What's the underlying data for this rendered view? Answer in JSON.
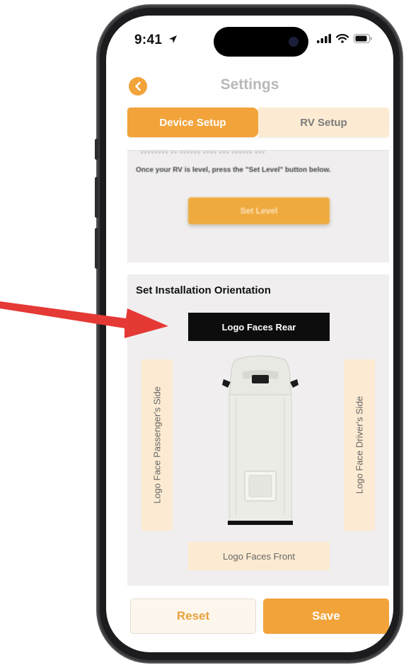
{
  "status_bar": {
    "time": "9:41",
    "location_icon": "location-arrow-icon",
    "signal_icon": "cellular-signal-icon",
    "wifi_icon": "wifi-icon",
    "battery_icon": "battery-icon"
  },
  "header": {
    "back_icon": "chevron-left-icon",
    "title": "Settings"
  },
  "tabs": [
    {
      "label": "Device Setup",
      "active": true
    },
    {
      "label": "RV Setup",
      "active": false
    }
  ],
  "level_section": {
    "instructions": "Once your RV is level, press the \"Set Level\" button below.",
    "set_level_label": "Set Level"
  },
  "orientation": {
    "title": "Set Installation Orientation",
    "rear_label": "Logo Faces Rear",
    "front_label": "Logo Faces Front",
    "passenger_label": "Logo Face Passenger's Side",
    "driver_label": "Logo Face Driver's Side",
    "selected": "Logo Faces Rear"
  },
  "footer": {
    "reset_label": "Reset",
    "save_label": "Save"
  },
  "colors": {
    "accent": "#f2a33a",
    "accent_light": "#fcebd2",
    "selected_option": "#0d0d0d",
    "card_background": "#f0eeee",
    "annotation_arrow": "#e53935"
  }
}
